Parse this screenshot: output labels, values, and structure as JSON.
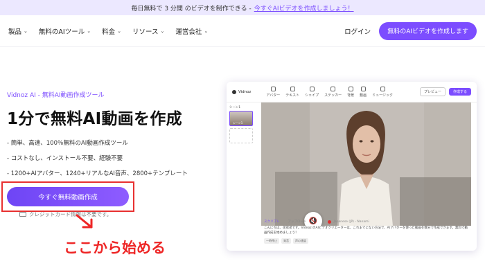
{
  "promo": {
    "text": "毎日無料で 3 分間 のビデオを制作できる -",
    "link": "今すぐAIビデオを作成しましょう！"
  },
  "nav": {
    "items": [
      {
        "label": "製品"
      },
      {
        "label": "無料のAIツール"
      },
      {
        "label": "料金"
      },
      {
        "label": "リソース"
      },
      {
        "label": "運営会社"
      }
    ],
    "login": "ログイン",
    "cta": "無料のAIビデオを作成します"
  },
  "hero": {
    "brand": "Vidnoz AI - 無料AI動画作成ツール",
    "title": "1分で無料AI動画を作成",
    "features": [
      "- 簡単、高速、100％無料のAI動画作成ツール",
      "- コストなし、インストール不要、経験不要",
      "- 1200+AIアバター、1240+リアルなAI音声、2800+テンプレート"
    ],
    "cta": "今すぐ無料動画作成",
    "note": "クレジットカード情報は不要です。",
    "annotation": "ここから始める"
  },
  "editor": {
    "logo": "Vidnoz",
    "tools": [
      "アバター",
      "テキスト",
      "シェイプ",
      "ステッカー",
      "背景",
      "動画",
      "ミュージック"
    ],
    "preview": "プレビュー",
    "create": "作成する",
    "scene_label": "シーン1",
    "scene_sub": "シーン1",
    "tabs": [
      "スクリプト",
      "アップロード"
    ],
    "voice": "Japanese (JP) - Nanami",
    "script": "こんにちは、弟弟弟です。Vidnoz のAIビデオクリエーターは、これまでにない方法で、AIアバターを使った動画を数分で作成できます。無料で動画作成を始めましょう！",
    "chips": [
      "一時停止",
      "発音",
      "声の速度"
    ]
  },
  "colors": {
    "accent": "#7c4dff",
    "annotation": "#ee2626"
  }
}
